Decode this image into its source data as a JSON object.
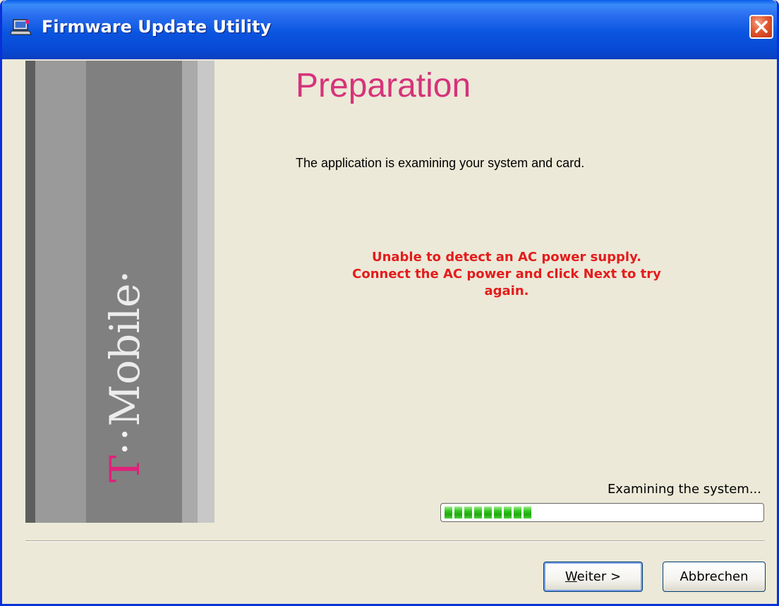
{
  "window": {
    "title": "Firmware Update Utility",
    "icon": "laptop-icon"
  },
  "branding": {
    "t": "T",
    "dots": "··",
    "word": "Mobile·",
    "accent_color": "#e0207a"
  },
  "content": {
    "heading": "Preparation",
    "intro": "The application is examining your system and card.",
    "warning_lines": [
      "Unable to detect an AC power supply.",
      "Connect the AC power and click Next to try",
      "again."
    ],
    "warning_color": "#e41c1c",
    "heading_color": "#d6337a"
  },
  "progress": {
    "status": "Examining the system...",
    "filled_segments": 9,
    "fraction": 0.3
  },
  "buttons": {
    "next_mnemonic": "W",
    "next_rest": "eiter >",
    "cancel": "Abbrechen"
  }
}
